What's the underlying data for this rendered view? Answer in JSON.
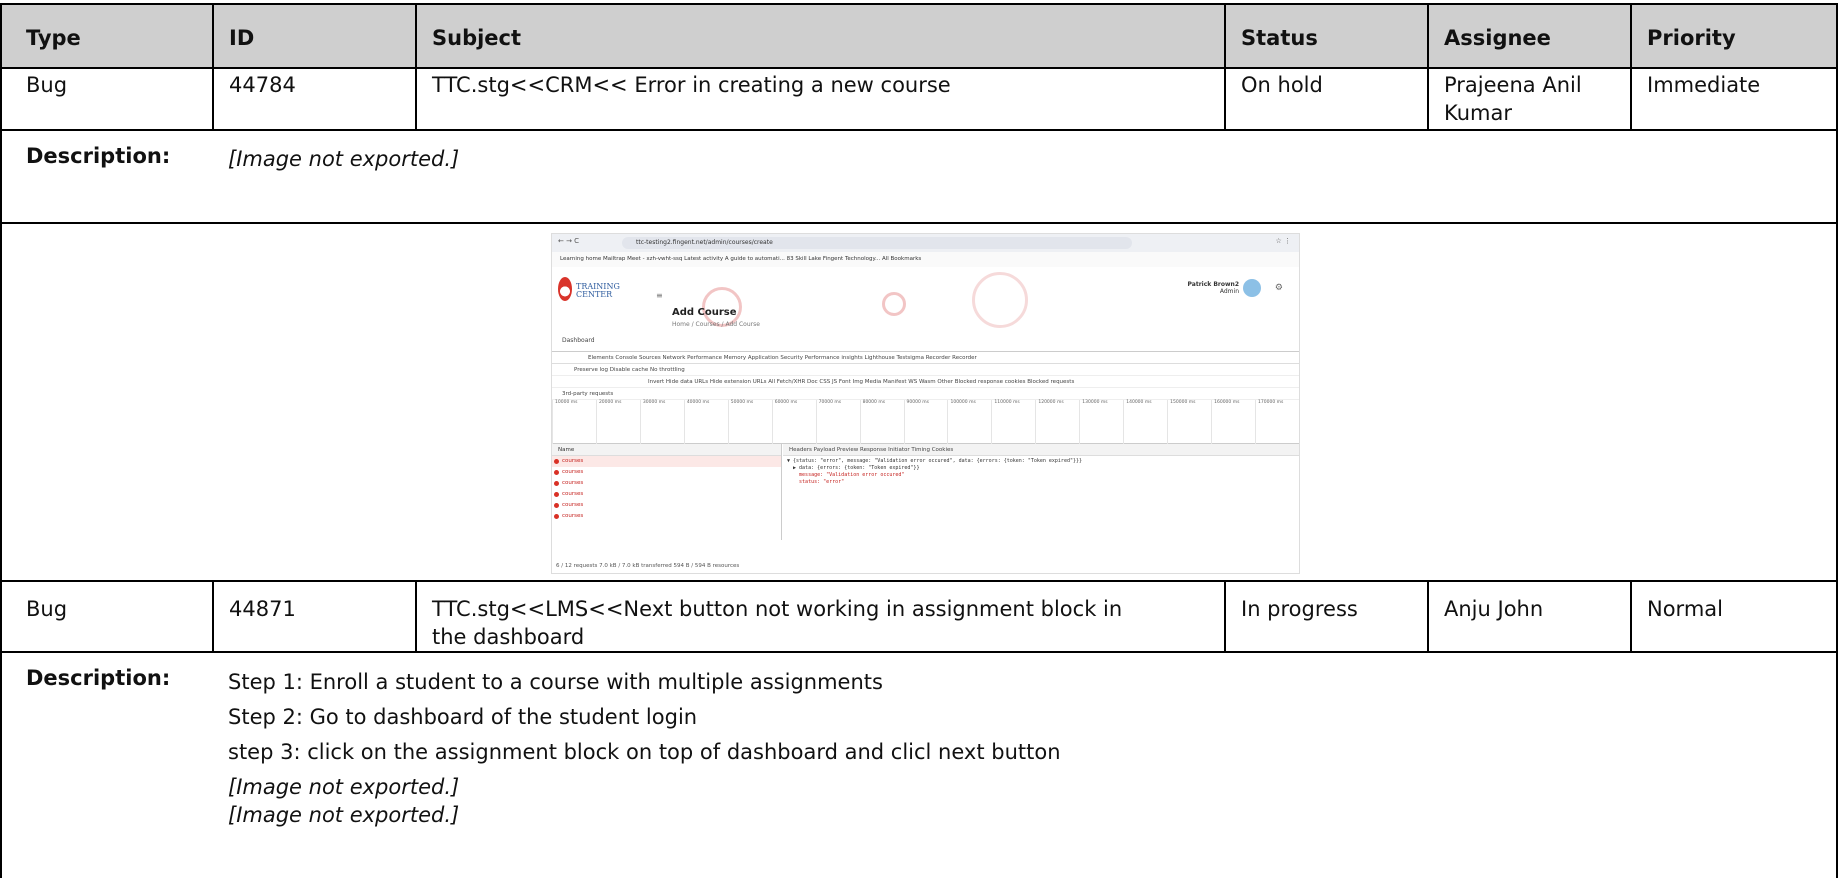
{
  "table": {
    "headers": [
      "Type",
      "ID",
      "Subject",
      "Status",
      "Assignee",
      "Priority"
    ],
    "description_label": "Description:",
    "issues": [
      {
        "type": "Bug",
        "id": "44784",
        "subject": "TTC.stg<<CRM<< Error in creating a new course",
        "status": "On hold",
        "assignee": "Prajeena Anil Kumar",
        "priority": "Immediate",
        "description_lines": [],
        "image_notes": [
          "[Image not exported.]"
        ]
      },
      {
        "type": "Bug",
        "id": "44871",
        "subject": "TTC.stg<<LMS<<Next button not working in assignment block in the dashboard",
        "status": "In progress",
        "assignee": "Anju John",
        "priority": "Normal",
        "description_lines": [
          "Step 1: Enroll a student to a course with multiple assignments",
          "Step 2: Go to dashboard of the student login",
          "step 3: click on the assignment block on top of dashboard and clicl next button"
        ],
        "image_notes": [
          "[Image not exported.]",
          "[Image not exported.]"
        ]
      }
    ]
  },
  "screenshot": {
    "url": "ttc-testing2.fingent.net/admin/courses/create",
    "bookmarks": "Learning home   Mailtrap   Meet - xzh-vwht-ssq   Latest activity   A guide to automati...   83   Skill Lake   Fingent Technology...   All Bookmarks",
    "logo_text": "TRAINING CENTER",
    "page_title": "Add Course",
    "breadcrumb": "Home / Courses / Add Course",
    "dashboard_link": "Dashboard",
    "user_name": "Patrick Brown2",
    "user_role": "Admin",
    "devtools_tabs": "Elements   Console   Sources   Network   Performance   Memory   Application   Security   Performance insights   Lighthouse   Testsigma Recorder   Recorder",
    "active_tab": "Network",
    "toolbar": "Preserve log   Disable cache   No throttling",
    "filter_bar": "Invert   Hide data URLs   Hide extension URLs   All   Fetch/XHR   Doc   CSS   JS   Font   Img   Media   Manifest   WS   Wasm   Other   Blocked response cookies   Blocked requests",
    "third_party": "3rd-party requests",
    "ticks": [
      "10000 ms",
      "20000 ms",
      "30000 ms",
      "40000 ms",
      "50000 ms",
      "60000 ms",
      "70000 ms",
      "80000 ms",
      "90000 ms",
      "100000 ms",
      "110000 ms",
      "120000 ms",
      "130000 ms",
      "140000 ms",
      "150000 ms",
      "160000 ms",
      "170000 ms"
    ],
    "names_header": "Name",
    "request_names": [
      "courses",
      "courses",
      "courses",
      "courses",
      "courses",
      "courses"
    ],
    "preview_tabs": "Headers   Payload   Preview   Response   Initiator   Timing   Cookies",
    "preview_lines": [
      "▼ {status: \"error\", message: \"Validation error occured\", data: {errors: {token: \"Token expired\"}}}",
      "  ▶ data: {errors: {token: \"Token expired\"}}",
      "    message: \"Validation error occured\"",
      "    status: \"error\""
    ],
    "footer": "6 / 12 requests   7.0 kB / 7.0 kB transferred   594 B / 594 B resources"
  }
}
